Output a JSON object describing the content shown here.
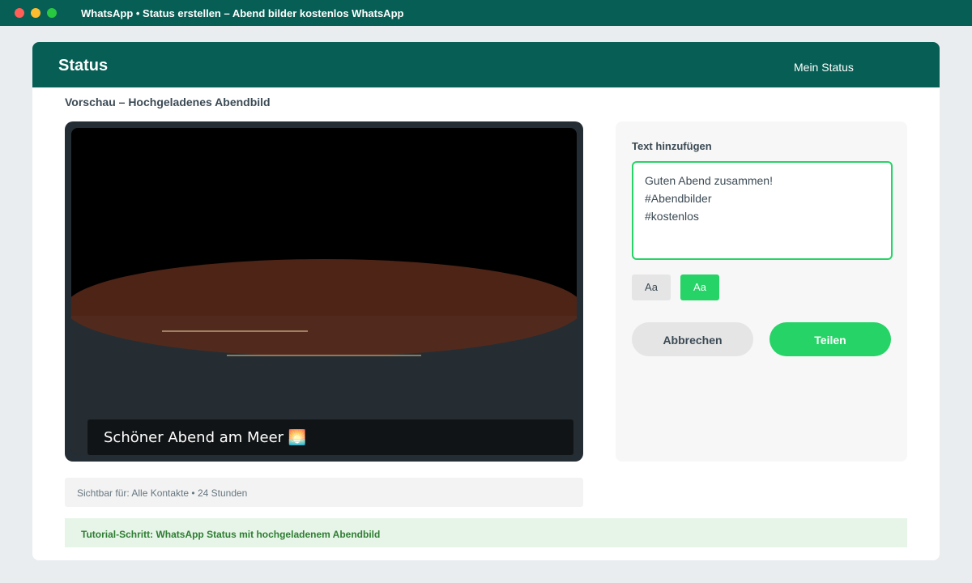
{
  "window": {
    "title": "WhatsApp • Status erstellen – Abend bilder kostenlos WhatsApp"
  },
  "header": {
    "title": "Status",
    "my_status_label": "Mein Status"
  },
  "preview": {
    "section_title": "Vorschau – Hochgeladenes Abendbild",
    "caption": "Schöner Abend am Meer 🌅",
    "visibility_text": "Sichtbar für: Alle Kontakte • 24 Stunden"
  },
  "side_panel": {
    "label": "Text hinzufügen",
    "text_lines": [
      "Guten Abend zusammen!",
      "#Abendbilder",
      "#kostenlos"
    ],
    "font_buttons": [
      "Aa",
      "Aa"
    ],
    "cancel_label": "Abbrechen",
    "share_label": "Teilen"
  },
  "tutorial": {
    "text": "Tutorial-Schritt: WhatsApp Status mit hochgeladenem Abendbild"
  },
  "colors": {
    "brand_dark": "#075e54",
    "accent_green": "#25d366",
    "sunset_orange": "#5a2a1a"
  },
  "icons": {
    "close": "red-dot",
    "minimize": "yellow-dot",
    "maximize": "green-dot"
  }
}
